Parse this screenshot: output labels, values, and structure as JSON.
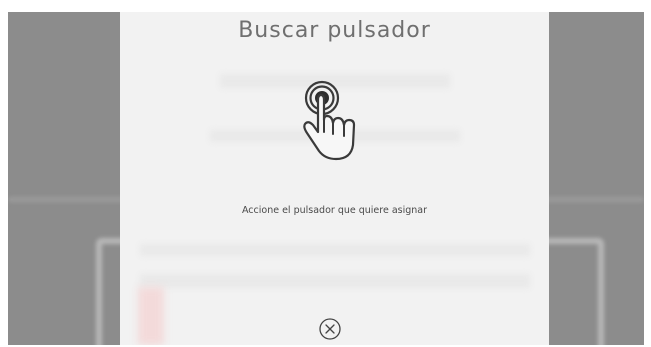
{
  "dialog": {
    "title": "Buscar pulsador",
    "message": "Accione el pulsador que quiere asignar",
    "icon": "touch-press-icon",
    "close_icon": "close-icon"
  },
  "colors": {
    "dialog_background": "#f2f2f2",
    "overlay": "#8c8c8c",
    "title_text": "#6f6f6f",
    "icon_stroke": "#3a3a3a",
    "message_text": "#4a4a4a"
  }
}
